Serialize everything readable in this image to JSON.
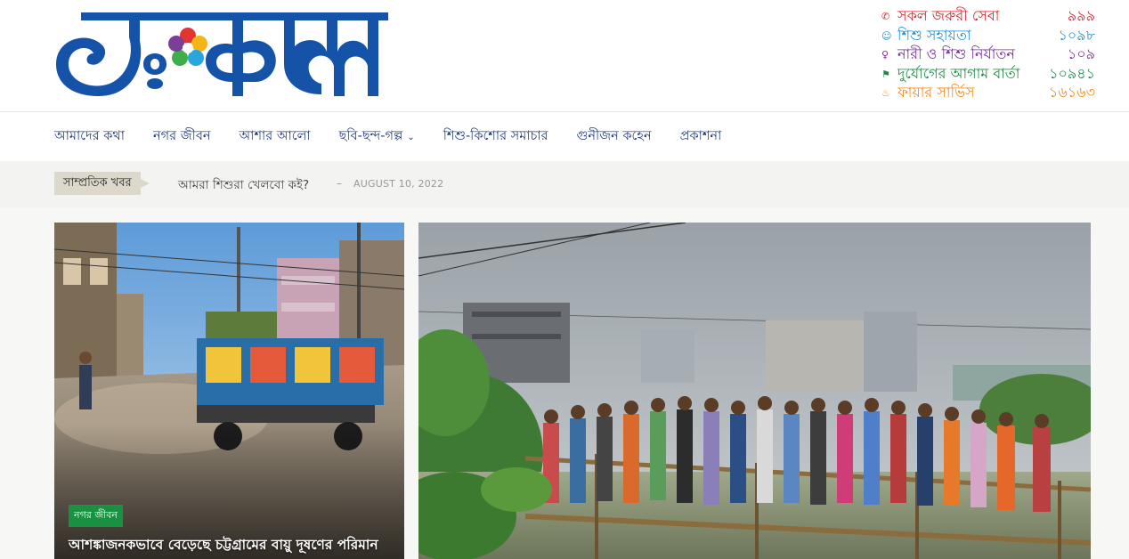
{
  "header": {
    "logo_text": "সংকল্প",
    "hotlines": [
      {
        "icon": "phone-icon",
        "glyph": "📞",
        "label": "সকল জরুরী সেবা",
        "number": "৯৯৯",
        "color": "#d0242b"
      },
      {
        "icon": "child-icon",
        "glyph": "☺",
        "label": "শিশু সহায়তা",
        "number": "১০৯৮",
        "color": "#1d8fd1"
      },
      {
        "icon": "female-icon",
        "glyph": "♀",
        "label": "নারী ও শিশু নির্যাতন",
        "number": "১০৯",
        "color": "#7a2a9e"
      },
      {
        "icon": "flag-icon",
        "glyph": "⚑",
        "label": "দুর্যোগের আগাম বার্তা",
        "number": "১০৯৪১",
        "color": "#1a8a45"
      },
      {
        "icon": "fire-icon",
        "glyph": "🔥",
        "label": "ফায়ার সার্ভিস",
        "number": "১৬১৬৩",
        "color": "#f08a1c"
      }
    ]
  },
  "nav": {
    "items": [
      {
        "label": "আমাদের কথা"
      },
      {
        "label": "নগর জীবন"
      },
      {
        "label": "আশার আলো"
      },
      {
        "label": "ছবি-ছন্দ-গল্প",
        "has_dropdown": true
      },
      {
        "label": "শিশু-কিশোর সমাচার"
      },
      {
        "label": "গুনীজন কহেন"
      },
      {
        "label": "প্রকাশনা"
      }
    ]
  },
  "ticker": {
    "badge": "সাম্প্রতিক খবর",
    "title": "আমরা শিশুরা খেলবো কই?",
    "separator": "–",
    "date": "AUGUST 10, 2022"
  },
  "featured": {
    "left": {
      "category": "নগর জীবন",
      "title": "আশঙ্কাজনকভাবে বেড়েছে চট্টগ্রামের বায়ু দূষণের পরিমান"
    }
  },
  "colors": {
    "brand_blue": "#1553a8",
    "nav_text": "#1f3a7a",
    "category_green": "#1a9142"
  }
}
